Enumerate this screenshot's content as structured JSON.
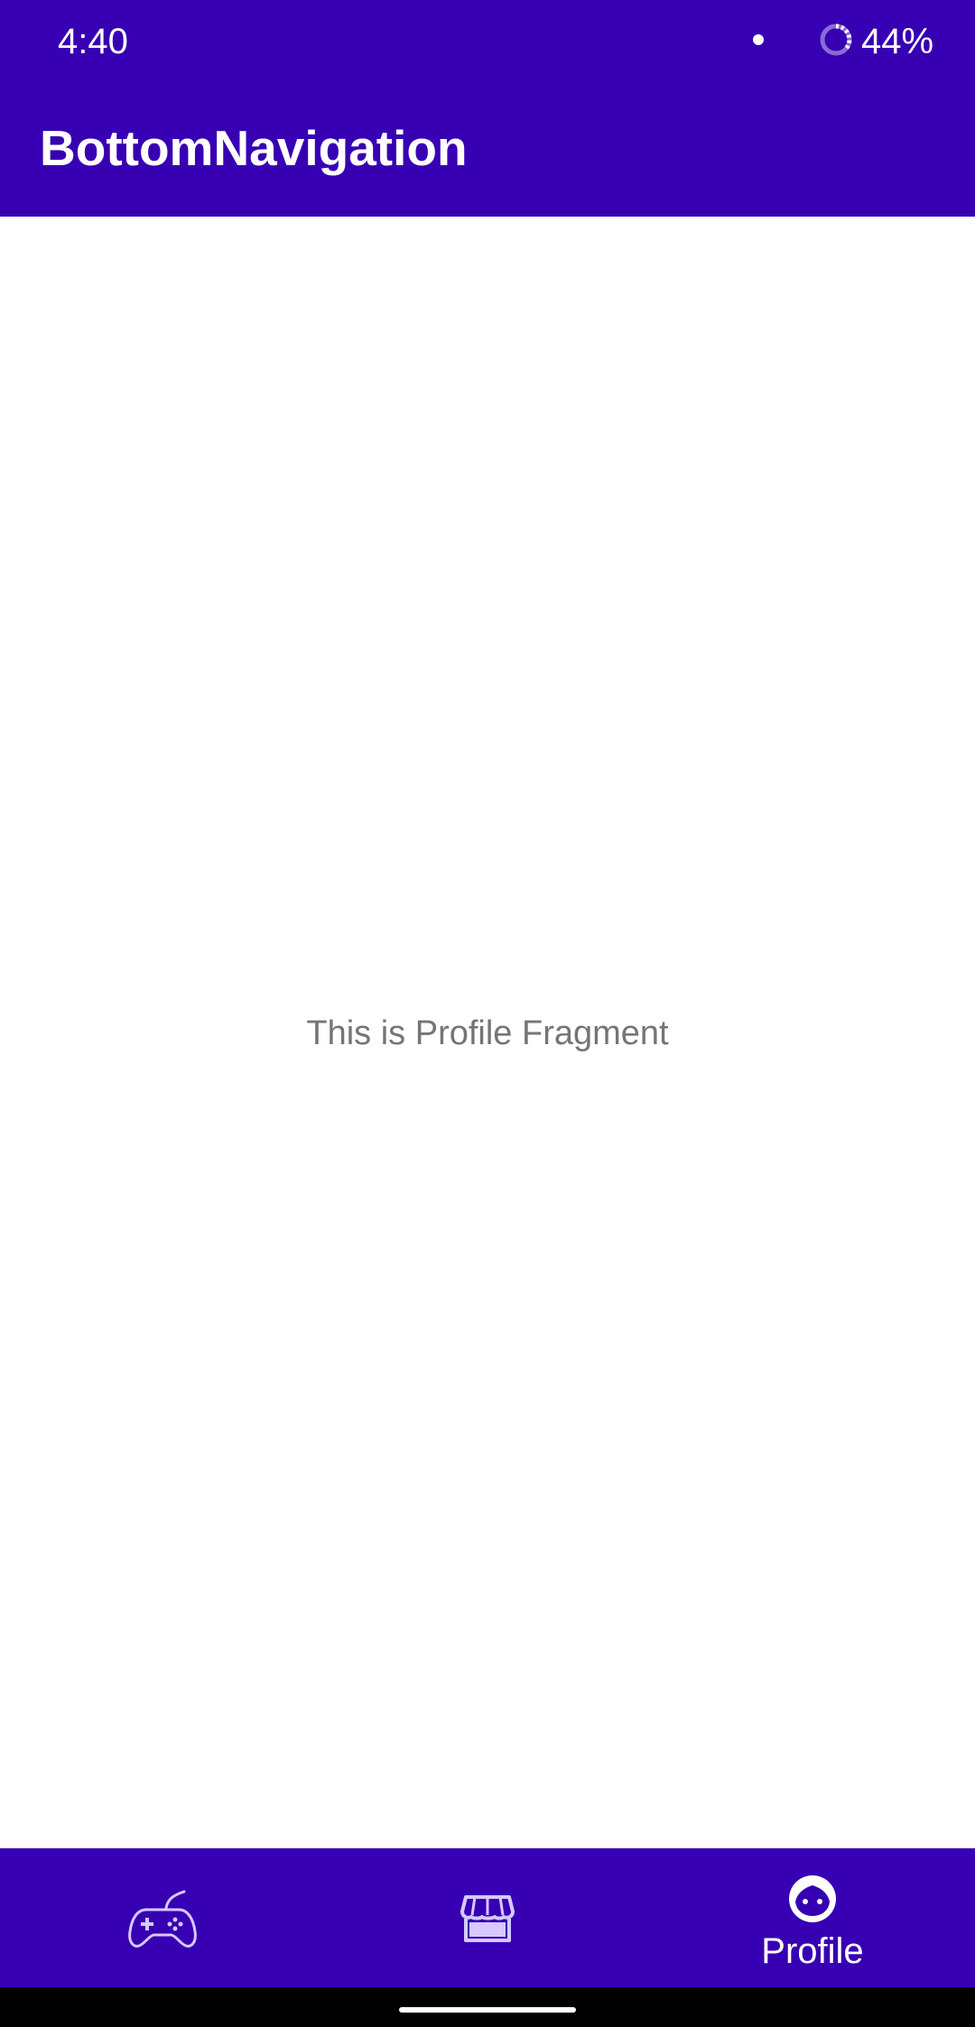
{
  "status_bar": {
    "time": "4:40",
    "battery": "44%"
  },
  "app_bar": {
    "title": "BottomNavigation"
  },
  "content": {
    "message": "This is Profile Fragment"
  },
  "bottom_nav": {
    "items": [
      {
        "icon": "gamepad-icon",
        "label": "",
        "selected": false
      },
      {
        "icon": "store-icon",
        "label": "",
        "selected": false
      },
      {
        "icon": "profile-face-icon",
        "label": "Profile",
        "selected": true
      }
    ]
  },
  "colors": {
    "primary": "#3700B3",
    "text_secondary": "#757575",
    "background": "#ffffff"
  }
}
